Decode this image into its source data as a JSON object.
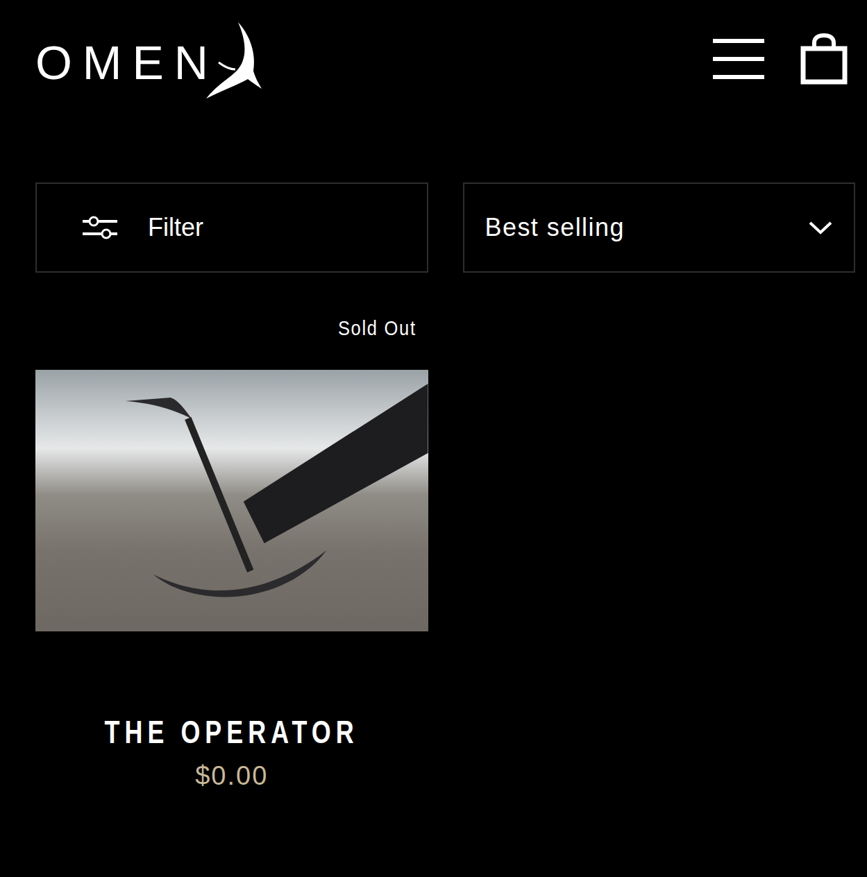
{
  "header": {
    "logo": "OMEN"
  },
  "controls": {
    "filter": "Filter",
    "sort": "Best selling"
  },
  "products": [
    {
      "badge": "Sold Out",
      "sold_out": true,
      "title": "THE OPERATOR",
      "price": "$0.00"
    }
  ]
}
